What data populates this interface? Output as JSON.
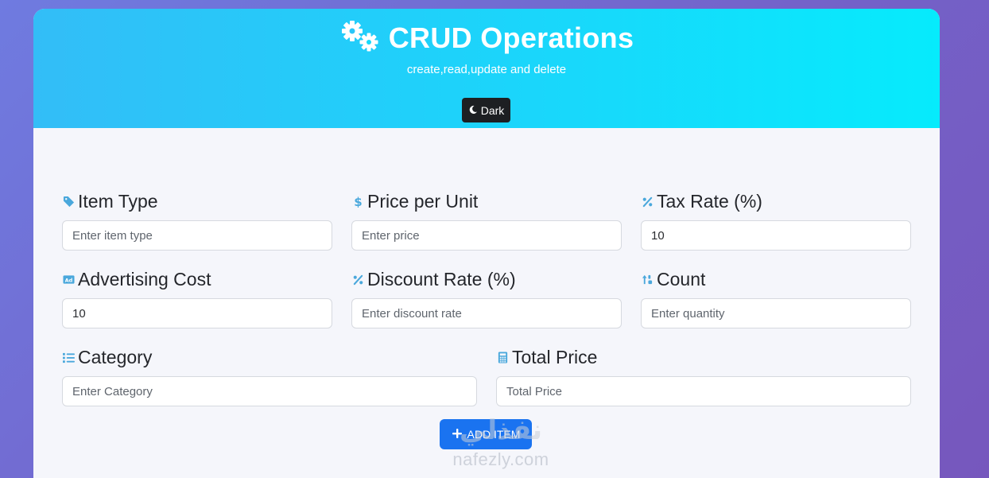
{
  "header": {
    "title": "CRUD Operations",
    "subtitle": "create,read,update and delete",
    "title_icon": "gears-icon",
    "theme_toggle": {
      "label": "Dark",
      "icon": "moon-icon"
    },
    "gradient": [
      "#33bdf7",
      "#06ebfc"
    ]
  },
  "form": {
    "item_type": {
      "label": "Item Type",
      "icon": "tag-icon",
      "placeholder": "Enter item type",
      "value": ""
    },
    "price_per_unit": {
      "label": "Price per Unit",
      "icon": "dollar-icon",
      "placeholder": "Enter price",
      "value": ""
    },
    "tax_rate": {
      "label": "Tax Rate (%)",
      "icon": "percent-icon",
      "placeholder": "",
      "value": "10"
    },
    "advertising_cost": {
      "label": "Advertising Cost",
      "icon": "ad-icon",
      "placeholder": "",
      "value": "10"
    },
    "discount_rate": {
      "label": "Discount Rate (%)",
      "icon": "percent-icon",
      "placeholder": "Enter discount rate",
      "value": ""
    },
    "count": {
      "label": "Count",
      "icon": "sort-numeric-icon",
      "placeholder": "Enter quantity",
      "value": ""
    },
    "category": {
      "label": "Category",
      "icon": "list-icon",
      "placeholder": "Enter Category",
      "value": ""
    },
    "total_price": {
      "label": "Total Price",
      "icon": "calculator-icon",
      "placeholder": "Total Price",
      "value": ""
    },
    "add_button": {
      "label": "ADD ITEM",
      "icon": "plus-icon",
      "color": "#1a73f0"
    }
  },
  "watermark": {
    "arabic": "نفذلي",
    "site": "nafezly.com"
  },
  "colors": {
    "icon_accent": "#4aa8dc",
    "dark_button": "#1d1f22"
  }
}
